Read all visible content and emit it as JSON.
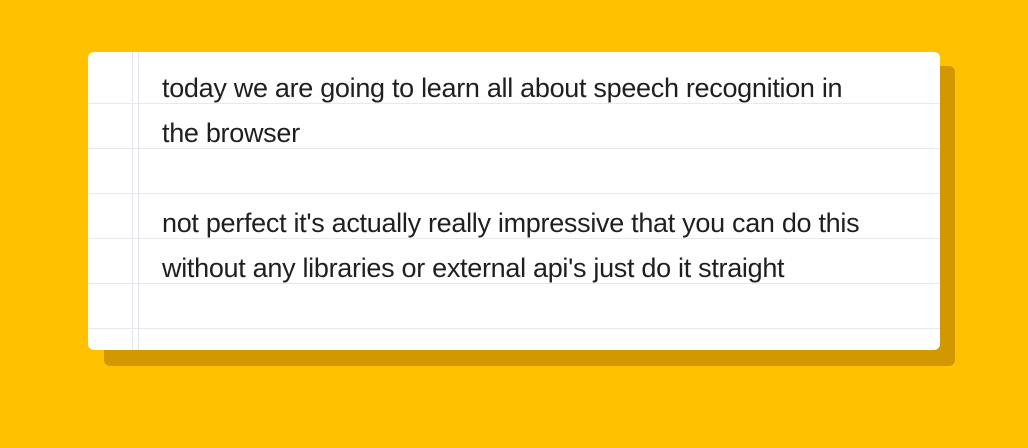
{
  "transcript": {
    "paragraphs": [
      {
        "lines": [
          "today we are going to learn all about speech recognition in",
          "the browser"
        ]
      },
      {
        "lines": [
          "not perfect it's actually really impressive that you can do this",
          "without any libraries or external api's just do it straight"
        ]
      }
    ]
  },
  "colors": {
    "background": "#FFC100",
    "paper": "#ffffff",
    "rule_line": "#e6e9ee",
    "text": "#1f1f1f"
  }
}
